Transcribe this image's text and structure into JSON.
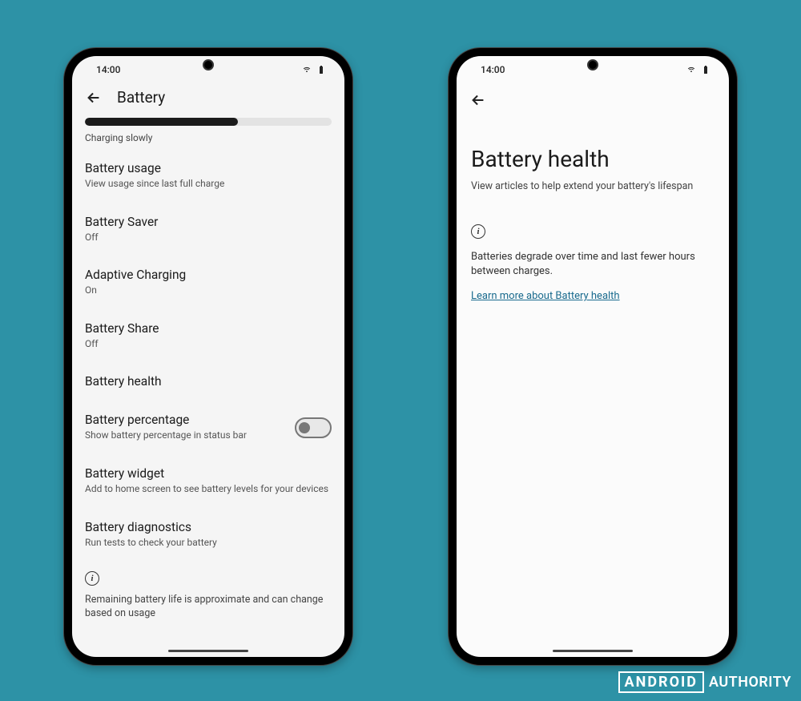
{
  "status": {
    "time": "14:00"
  },
  "left": {
    "title": "Battery",
    "charging_status": "Charging slowly",
    "progress_percent": 62,
    "items": [
      {
        "title": "Battery usage",
        "sub": "View usage since last full charge"
      },
      {
        "title": "Battery Saver",
        "sub": "Off"
      },
      {
        "title": "Adaptive Charging",
        "sub": "On"
      },
      {
        "title": "Battery Share",
        "sub": "Off"
      },
      {
        "title": "Battery health",
        "sub": ""
      },
      {
        "title": "Battery percentage",
        "sub": "Show battery percentage in status bar"
      },
      {
        "title": "Battery widget",
        "sub": "Add to home screen to see battery levels for your devices"
      },
      {
        "title": "Battery diagnostics",
        "sub": "Run tests to check your battery"
      }
    ],
    "footer_note": "Remaining battery life is approximate and can change based on usage"
  },
  "right": {
    "title": "Battery health",
    "subtitle": "View articles to help extend your battery's lifespan",
    "info_body": "Batteries degrade over time and last fewer hours between charges.",
    "link_text": "Learn more about Battery health"
  },
  "watermark": {
    "boxed": "ANDROID",
    "rest": "AUTHORITY"
  }
}
